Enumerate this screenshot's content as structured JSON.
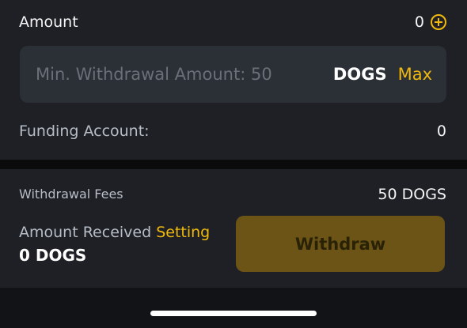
{
  "amount": {
    "label": "Amount",
    "value": "0",
    "add_icon": "plus-circle-icon",
    "input_placeholder": "Min. Withdrawal Amount: 50",
    "input_value": "",
    "unit": "DOGS",
    "max_label": "Max"
  },
  "funding": {
    "label": "Funding Account:",
    "value": "0"
  },
  "summary": {
    "fees_label": "Withdrawal Fees",
    "fees_value": "50 DOGS",
    "received_label": "Amount Received",
    "setting_label": "Setting",
    "received_value": "0 DOGS",
    "withdraw_label": "Withdraw"
  },
  "colors": {
    "accent": "#f0b90b",
    "panel": "#1e2026",
    "input_bg": "#2b2f36",
    "button_disabled": "#6b5416"
  }
}
